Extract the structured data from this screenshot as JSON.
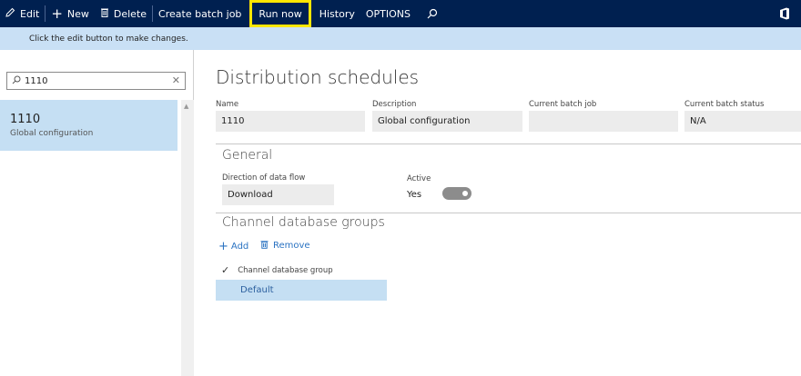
{
  "toolbar": {
    "edit": "Edit",
    "new": "New",
    "delete": "Delete",
    "create_batch_job": "Create batch job",
    "run_now": "Run now",
    "history": "History",
    "options": "OPTIONS"
  },
  "infobar": {
    "message": "Click the edit button to make changes."
  },
  "left": {
    "search_value": "1110",
    "items": [
      {
        "title": "1110",
        "subtitle": "Global configuration"
      }
    ]
  },
  "main": {
    "title": "Distribution schedules",
    "fields": {
      "name_label": "Name",
      "name_value": "1110",
      "description_label": "Description",
      "description_value": "Global configuration",
      "current_batch_job_label": "Current batch job",
      "current_batch_job_value": "",
      "current_batch_status_label": "Current batch status",
      "current_batch_status_value": "N/A"
    },
    "general": {
      "title": "General",
      "direction_label": "Direction of data flow",
      "direction_value": "Download",
      "active_label": "Active",
      "active_value": "Yes"
    },
    "channel_groups": {
      "title": "Channel database groups",
      "add": "Add",
      "remove": "Remove",
      "column_header": "Channel database group",
      "rows": [
        "Default"
      ]
    }
  },
  "colors": {
    "topbar": "#002050",
    "infobar": "#c9e0f5",
    "selected": "#c5dff3",
    "highlight": "#ffe600",
    "link": "#2b73c2"
  }
}
